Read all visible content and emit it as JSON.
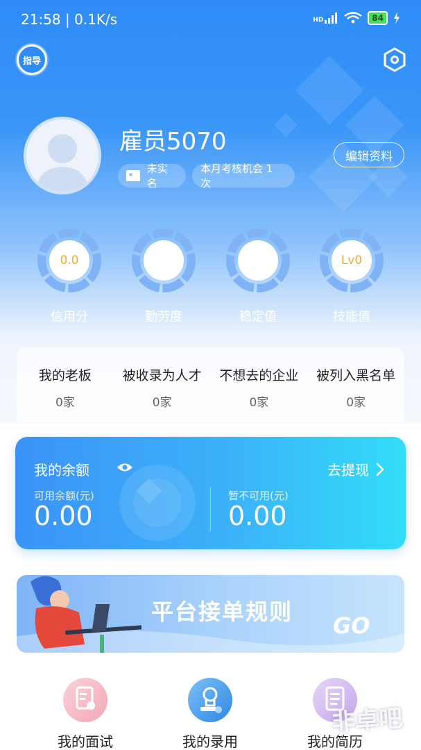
{
  "status_bar": {
    "time": "21:58",
    "speed": "0.1K/s",
    "network": "HD",
    "battery": "84"
  },
  "header": {
    "guide_label": "指导"
  },
  "profile": {
    "name": "雇员5070",
    "verify_tag": "未实名",
    "chance_tag": "本月考核机会 1 次",
    "edit_label": "编辑资料"
  },
  "stats": [
    {
      "label": "信用分",
      "value": "0.0"
    },
    {
      "label": "勤劳度",
      "value": ""
    },
    {
      "label": "稳定值",
      "value": ""
    },
    {
      "label": "技能值",
      "value": "Lv0"
    }
  ],
  "relations": [
    {
      "title": "我的老板",
      "count": "0家"
    },
    {
      "title": "被收录为人才",
      "count": "0家"
    },
    {
      "title": "不想去的企业",
      "count": "0家"
    },
    {
      "title": "被列入黑名单",
      "count": "0家"
    }
  ],
  "balance": {
    "title": "我的余额",
    "withdraw_label": "去提现",
    "available_label": "可用余额(元)",
    "available_value": "0.00",
    "unavailable_label": "暂不可用(元)",
    "unavailable_value": "0.00"
  },
  "banner": {
    "title": "平台接单规则",
    "go_text": "GO"
  },
  "menu": [
    {
      "label": "我的面试",
      "icon": "interview-doc-icon"
    },
    {
      "label": "我的录用",
      "icon": "stamp-icon"
    },
    {
      "label": "我的简历",
      "icon": "resume-doc-icon"
    }
  ],
  "watermark": "非卓吧",
  "colors": {
    "primary_blue": "#2f8cf7",
    "ring_blue": "#7fb3f6",
    "score_orange": "#f0a93a"
  }
}
